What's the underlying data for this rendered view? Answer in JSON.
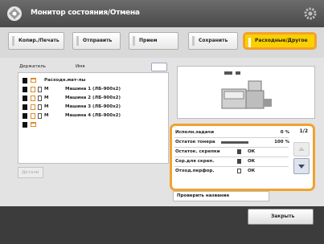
{
  "header": {
    "title": "Монитор состояния/Отмена"
  },
  "tabs": [
    {
      "label": "Копир./Печать"
    },
    {
      "label": "Отправить"
    },
    {
      "label": "Прием"
    },
    {
      "label": "Сохранить"
    },
    {
      "label": "Расходные/Другое"
    }
  ],
  "job_list": {
    "col_owner": "Держатель",
    "col_name": "Имя",
    "rows": [
      {
        "kind": "",
        "name": "Расходн.мат-лы"
      },
      {
        "kind": "М",
        "name": "Машина 1 (ЛБ-900х2)"
      },
      {
        "kind": "М",
        "name": "Машина 2 (ЛБ-900х2)"
      },
      {
        "kind": "М",
        "name": "Машина 3 (ЛБ-900х2)"
      },
      {
        "kind": "М",
        "name": "Машина 4 (ЛБ-900х2)"
      },
      {
        "kind": "",
        "name": ""
      }
    ],
    "details_label": "Детали"
  },
  "status": {
    "page": "1/2",
    "rows": [
      {
        "label": "Исполн.задачи",
        "value": "0 %"
      },
      {
        "label": "Остаток тонера",
        "value": "100 %"
      },
      {
        "label": "Остаток. скрепки",
        "value": "ОК"
      },
      {
        "label": "Сор.для скреп.",
        "value": "ОК"
      },
      {
        "label": "Отход.перфор.",
        "value": "ОК"
      }
    ]
  },
  "check_button": "Проверить название",
  "footer": {
    "close": "Закрыть"
  },
  "colors": {
    "accent": "#f2a22e",
    "active_tab": "#fbd000"
  }
}
